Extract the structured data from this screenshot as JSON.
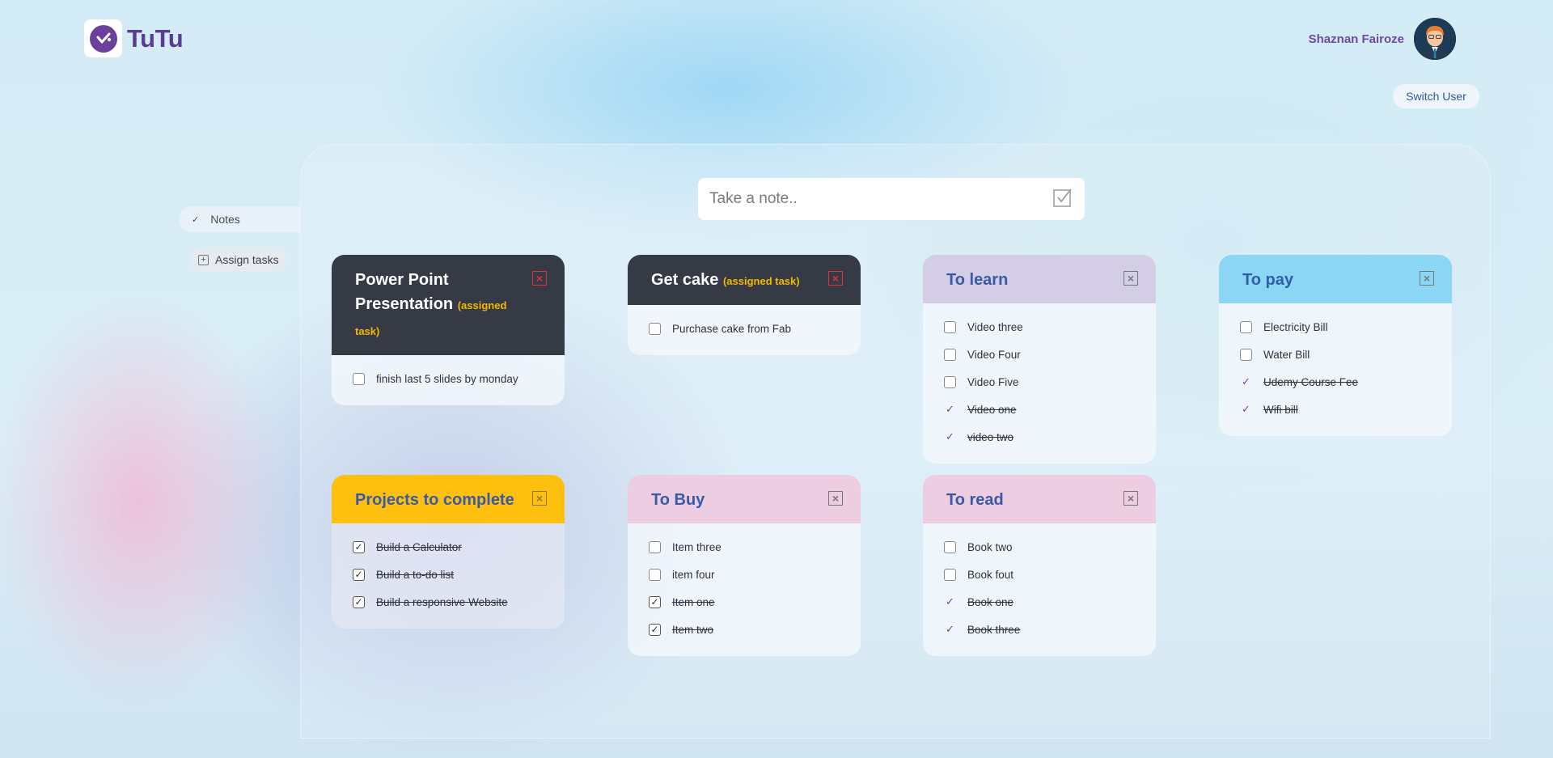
{
  "app": {
    "name": "TuTu"
  },
  "user": {
    "name": "Shaznan Fairoze",
    "switch_label": "Switch User"
  },
  "sidebar": {
    "notes_label": "Notes",
    "assign_label": "Assign tasks"
  },
  "note_input": {
    "placeholder": "Take a note.."
  },
  "cards": [
    {
      "title": "Power Point Presentation",
      "assigned_label": "(assigned task)",
      "header_color": "#353a44",
      "items": [
        {
          "text": "finish last 5 slides by monday",
          "done": false
        }
      ]
    },
    {
      "title": "Get cake",
      "assigned_label": "(assigned task)",
      "header_color": "#353a44",
      "items": [
        {
          "text": "Purchase cake from Fab",
          "done": false
        }
      ]
    },
    {
      "title": "To learn",
      "header_color": "#d3cde5",
      "items": [
        {
          "text": "Video three",
          "done": false
        },
        {
          "text": "Video Four",
          "done": false
        },
        {
          "text": "Video Five",
          "done": false
        },
        {
          "text": "Video one",
          "done": true
        },
        {
          "text": "video two",
          "done": true
        }
      ]
    },
    {
      "title": "To pay",
      "header_color": "#8bd5f5",
      "items": [
        {
          "text": "Electricity Bill",
          "done": false
        },
        {
          "text": "Water Bill",
          "done": false
        },
        {
          "text": "Udemy Course Fee",
          "done": true
        },
        {
          "text": "Wifi bill",
          "done": true
        }
      ]
    },
    {
      "title": "Projects to complete",
      "header_color": "#fdc00f",
      "items": [
        {
          "text": "Build a Calculator",
          "done": true
        },
        {
          "text": "Build a to-do list",
          "done": true
        },
        {
          "text": "Build a responsive Website",
          "done": true
        }
      ]
    },
    {
      "title": "To Buy",
      "header_color": "#eccde2",
      "items": [
        {
          "text": "Item three",
          "done": false
        },
        {
          "text": "item four",
          "done": false
        },
        {
          "text": "Item one",
          "done": true
        },
        {
          "text": "Item two",
          "done": true
        }
      ]
    },
    {
      "title": "To read",
      "header_color": "#eccde2",
      "items": [
        {
          "text": "Book two",
          "done": false
        },
        {
          "text": "Book fout",
          "done": false
        },
        {
          "text": "Book one",
          "done": true
        },
        {
          "text": "Book three",
          "done": true
        }
      ]
    }
  ]
}
